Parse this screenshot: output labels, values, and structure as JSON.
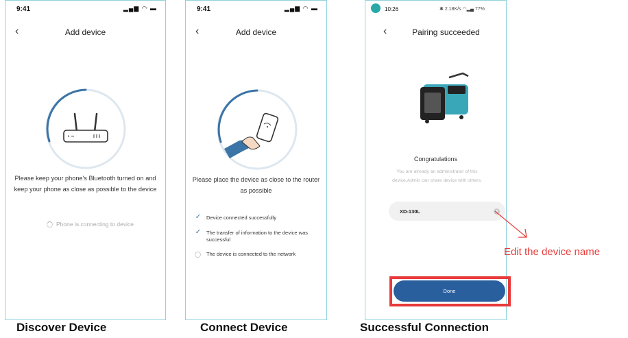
{
  "screens": {
    "discover": {
      "time": "9:41",
      "title": "Add device",
      "instruction": "Please keep your phone's Bluetooth turned on and keep your phone as close as possible to the device",
      "status": "Phone is connecting to device",
      "caption": "Discover Device"
    },
    "connect": {
      "time": "9:41",
      "title": "Add device",
      "instruction": "Please place the device as close to the router as possible",
      "steps": [
        {
          "label": "Device connected successfully",
          "done": true
        },
        {
          "label": "The transfer of information to the device was successful",
          "done": true
        },
        {
          "label": "The device is connected to the network",
          "done": false
        }
      ],
      "caption": "Connect Device"
    },
    "success": {
      "time": "10:26",
      "status_right": "2.18K/s",
      "battery": "77%",
      "title": "Pairing succeeded",
      "congrats": "Congratulations",
      "admin_note": "You are already an administrator of this device,Admin can share device with others.",
      "device_name": "XD-130L",
      "done_label": "Done",
      "caption": "Successful Connection"
    }
  },
  "annotation": "Edit the device name",
  "colors": {
    "accent_blue": "#2a5f9e",
    "highlight_red": "#e83a3a",
    "frame_border": "#8fd3dc"
  }
}
